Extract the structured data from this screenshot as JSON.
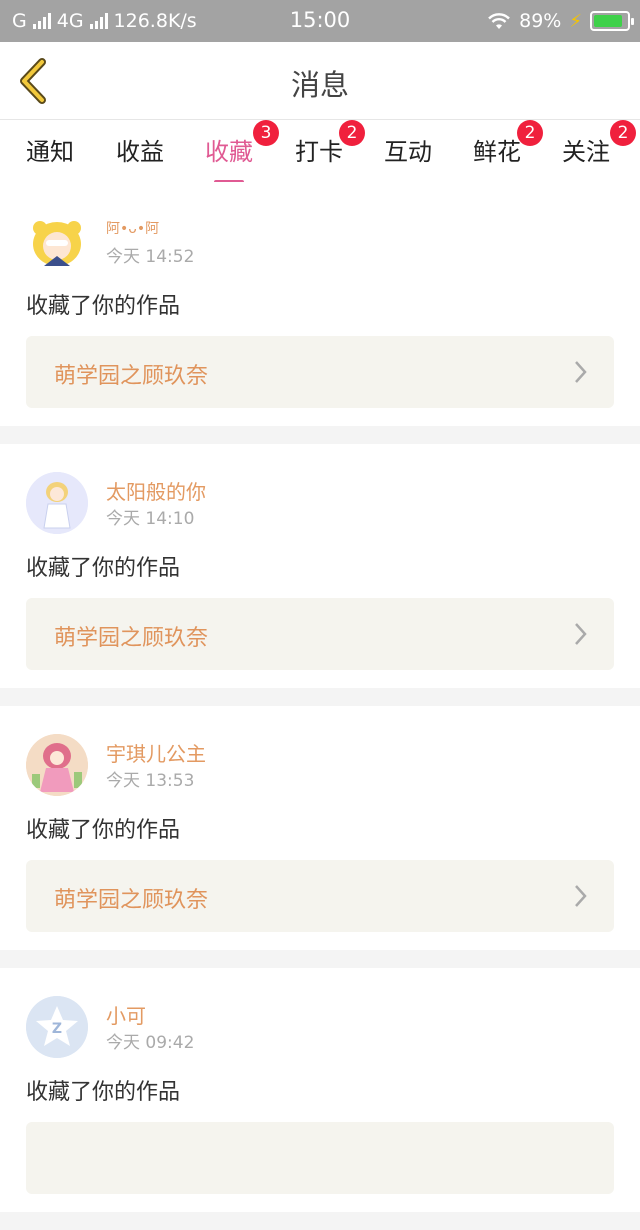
{
  "status_bar": {
    "carrier": "G",
    "network": "4G",
    "speed": "126.8K/s",
    "time": "15:00",
    "battery": "89%",
    "battery_fill": 0.89
  },
  "header": {
    "title": "消息"
  },
  "tabs": [
    {
      "label": "通知",
      "badge": ""
    },
    {
      "label": "收益",
      "badge": ""
    },
    {
      "label": "收藏",
      "badge": "3",
      "active": true
    },
    {
      "label": "打卡",
      "badge": "2"
    },
    {
      "label": "互动",
      "badge": ""
    },
    {
      "label": "鲜花",
      "badge": "2"
    },
    {
      "label": "关注",
      "badge": "2"
    }
  ],
  "feed": [
    {
      "user": "阿•ᴗ•阿",
      "time": "今天 14:52",
      "action": "收藏了你的作品",
      "work": "萌学园之顾玖奈"
    },
    {
      "user": "太阳般的你",
      "time": "今天 14:10",
      "action": "收藏了你的作品",
      "work": "萌学园之顾玖奈"
    },
    {
      "user": "宇琪儿公主",
      "time": "今天 13:53",
      "action": "收藏了你的作品",
      "work": "萌学园之顾玖奈"
    },
    {
      "user": "小可",
      "time": "今天 09:42",
      "action": "收藏了你的作品",
      "work": ""
    }
  ],
  "colors": {
    "accent_pink": "#e05a93",
    "badge_red": "#f0203d",
    "username_orange": "#e39a62",
    "work_bg": "#f5f4ee"
  }
}
